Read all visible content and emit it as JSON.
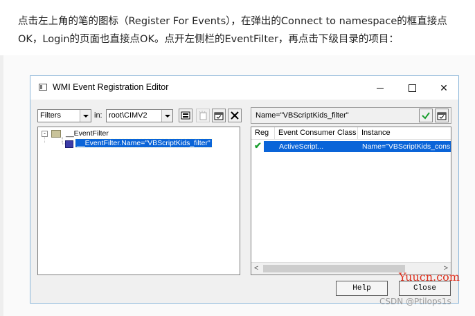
{
  "article": {
    "text": "点击左上角的笔的图标（Register For Events），在弹出的Connect to namespace的框直接点OK，Login的页面也直接点OK。点开左侧栏的EventFilter，再点击下级目录的项目："
  },
  "window": {
    "title": "WMI Event Registration Editor",
    "minimize": "minimize",
    "maximize": "maximize",
    "close": "✕"
  },
  "left_toolbar": {
    "filter_select": "Filters",
    "in_label": "in:",
    "namespace_select": "root\\CIMV2"
  },
  "tree": {
    "root_label": "__EventFilter",
    "expander": "-",
    "child_label": "__EventFilter.Name=\"VBScriptKids_filter\""
  },
  "right_panel": {
    "header_text": "Name=\"VBScriptKids_filter\"",
    "columns": [
      "Reg",
      "Event Consumer Class",
      "Instance"
    ],
    "rows": [
      {
        "registered": "✔",
        "consumer_class": "ActiveScript...",
        "instance": "Name=\"VBScriptKids_cons"
      }
    ],
    "scroll_left": "<",
    "scroll_right": ">"
  },
  "buttons": {
    "help": "Help",
    "close": "Close"
  },
  "watermarks": {
    "site": "Yuucn.com",
    "author": "CSDN @Ptilops1s"
  },
  "colors": {
    "selection": "#0a64d8",
    "check": "#1a9e2e",
    "window_border": "#8bb6d9"
  }
}
